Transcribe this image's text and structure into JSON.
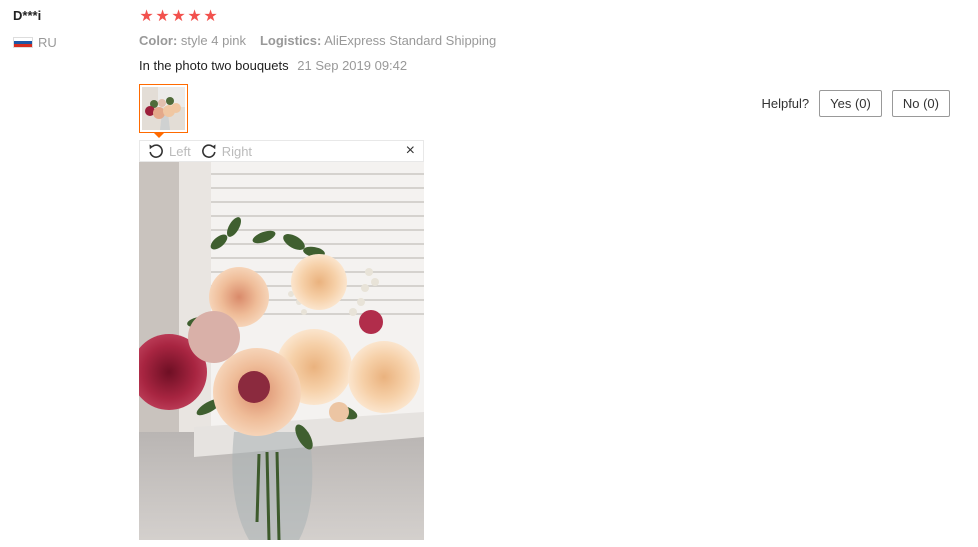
{
  "reviewer": {
    "name": "D***i",
    "country_code": "RU"
  },
  "rating": {
    "stars": 5,
    "out_of": 5
  },
  "sku": {
    "color_key": "Color:",
    "color_value": "style 4 pink",
    "logistics_key": "Logistics:",
    "logistics_value": "AliExpress Standard Shipping"
  },
  "review": {
    "text": "In the photo two bouquets",
    "date": "21 Sep 2019 09:42"
  },
  "helpful": {
    "label": "Helpful?",
    "yes_label": "Yes (0)",
    "no_label": "No (0)"
  },
  "viewer": {
    "rotate_left_label": "Left",
    "rotate_right_label": "Right",
    "close_glyph": "×"
  },
  "icons": {
    "star": "star-icon",
    "rotate_left": "rotate-left-icon",
    "rotate_right": "rotate-right-icon",
    "close": "close-icon",
    "flag": "russia-flag-icon"
  },
  "colors": {
    "star": "#f2514d",
    "thumb_border": "#ff6a00",
    "muted_text": "#999999"
  }
}
